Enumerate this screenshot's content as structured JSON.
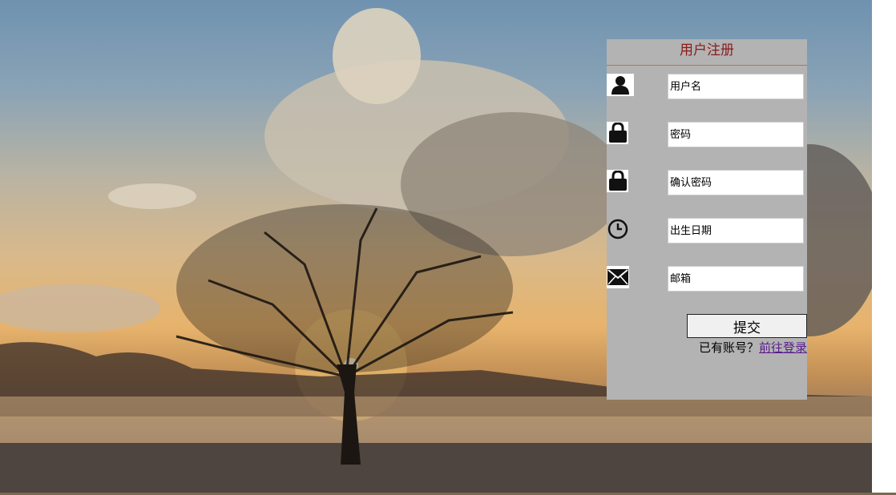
{
  "form": {
    "title": "用户注册",
    "fields": [
      {
        "icon": "user-icon",
        "placeholder": "用户名"
      },
      {
        "icon": "lock-icon",
        "placeholder": "密码"
      },
      {
        "icon": "lock-icon",
        "placeholder": "确认密码"
      },
      {
        "icon": "clock-icon",
        "placeholder": "出生日期"
      },
      {
        "icon": "mail-icon",
        "placeholder": "邮箱"
      }
    ],
    "submit_label": "提交",
    "login_prompt": "已有账号？",
    "login_link": "前往登录"
  },
  "colors": {
    "panel_bg": "#b3b3b3",
    "title_color": "#8b1a1a",
    "link_color": "#5a1a8c"
  }
}
